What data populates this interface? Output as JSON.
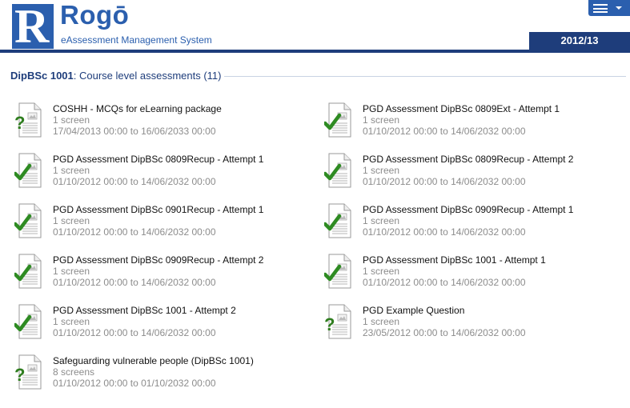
{
  "app": {
    "logo_letter": "R",
    "name": "Rogō",
    "subtitle": "eAssessment Management System",
    "year": "2012/13"
  },
  "section": {
    "module": "DipBSc 1001",
    "rest": ": Course level assessments (11)"
  },
  "colors": {
    "brand": "#2b5fae",
    "navy": "#1e3d7b",
    "check": "#2e8b22",
    "question": "#2e7d1e"
  },
  "assessments": [
    {
      "title": "COSHH - MCQs for eLearning package",
      "screens": "1 screen",
      "dates": "17/04/2013 00:00 to 16/06/2033 00:00",
      "status": "question"
    },
    {
      "title": "PGD Assessment DipBSc 0809Ext - Attempt 1",
      "screens": "1 screen",
      "dates": "01/10/2012 00:00 to 14/06/2032 00:00",
      "status": "check"
    },
    {
      "title": "PGD Assessment DipBSc 0809Recup - Attempt 1",
      "screens": "1 screen",
      "dates": "01/10/2012 00:00 to 14/06/2032 00:00",
      "status": "check"
    },
    {
      "title": "PGD Assessment DipBSc 0809Recup - Attempt 2",
      "screens": "1 screen",
      "dates": "01/10/2012 00:00 to 14/06/2032 00:00",
      "status": "check"
    },
    {
      "title": "PGD Assessment DipBSc 0901Recup - Attempt 1",
      "screens": "1 screen",
      "dates": "01/10/2012 00:00 to 14/06/2032 00:00",
      "status": "check"
    },
    {
      "title": "PGD Assessment DipBSc 0909Recup - Attempt 1",
      "screens": "1 screen",
      "dates": "01/10/2012 00:00 to 14/06/2032 00:00",
      "status": "check"
    },
    {
      "title": "PGD Assessment DipBSc 0909Recup - Attempt 2",
      "screens": "1 screen",
      "dates": "01/10/2012 00:00 to 14/06/2032 00:00",
      "status": "check"
    },
    {
      "title": "PGD Assessment DipBSc 1001 - Attempt 1",
      "screens": "1 screen",
      "dates": "01/10/2012 00:00 to 14/06/2032 00:00",
      "status": "check"
    },
    {
      "title": "PGD Assessment DipBSc 1001 - Attempt 2",
      "screens": "1 screen",
      "dates": "01/10/2012 00:00 to 14/06/2032 00:00",
      "status": "check"
    },
    {
      "title": "PGD Example Question",
      "screens": "1 screen",
      "dates": "23/05/2012 00:00 to 14/06/2032 00:00",
      "status": "question"
    },
    {
      "title": "Safeguarding vulnerable people (DipBSc 1001)",
      "screens": "8 screens",
      "dates": "01/10/2012 00:00 to 01/10/2032 00:00",
      "status": "question"
    }
  ]
}
